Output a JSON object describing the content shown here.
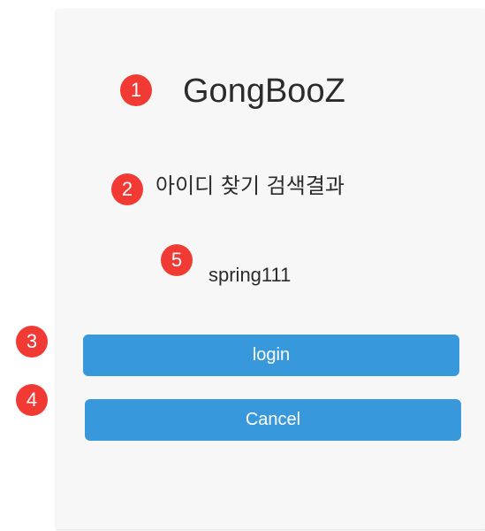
{
  "app": {
    "title": "GongBooZ"
  },
  "header": {
    "subtitle": "아이디 찾기 검색결과"
  },
  "result": {
    "found_id": "spring111"
  },
  "buttons": {
    "login_label": "login",
    "cancel_label": "Cancel"
  },
  "markers": [
    "1",
    "2",
    "3",
    "4",
    "5"
  ],
  "colors": {
    "marker": "#f03a33",
    "button": "#3799dc",
    "panel": "#f7f7f7"
  }
}
